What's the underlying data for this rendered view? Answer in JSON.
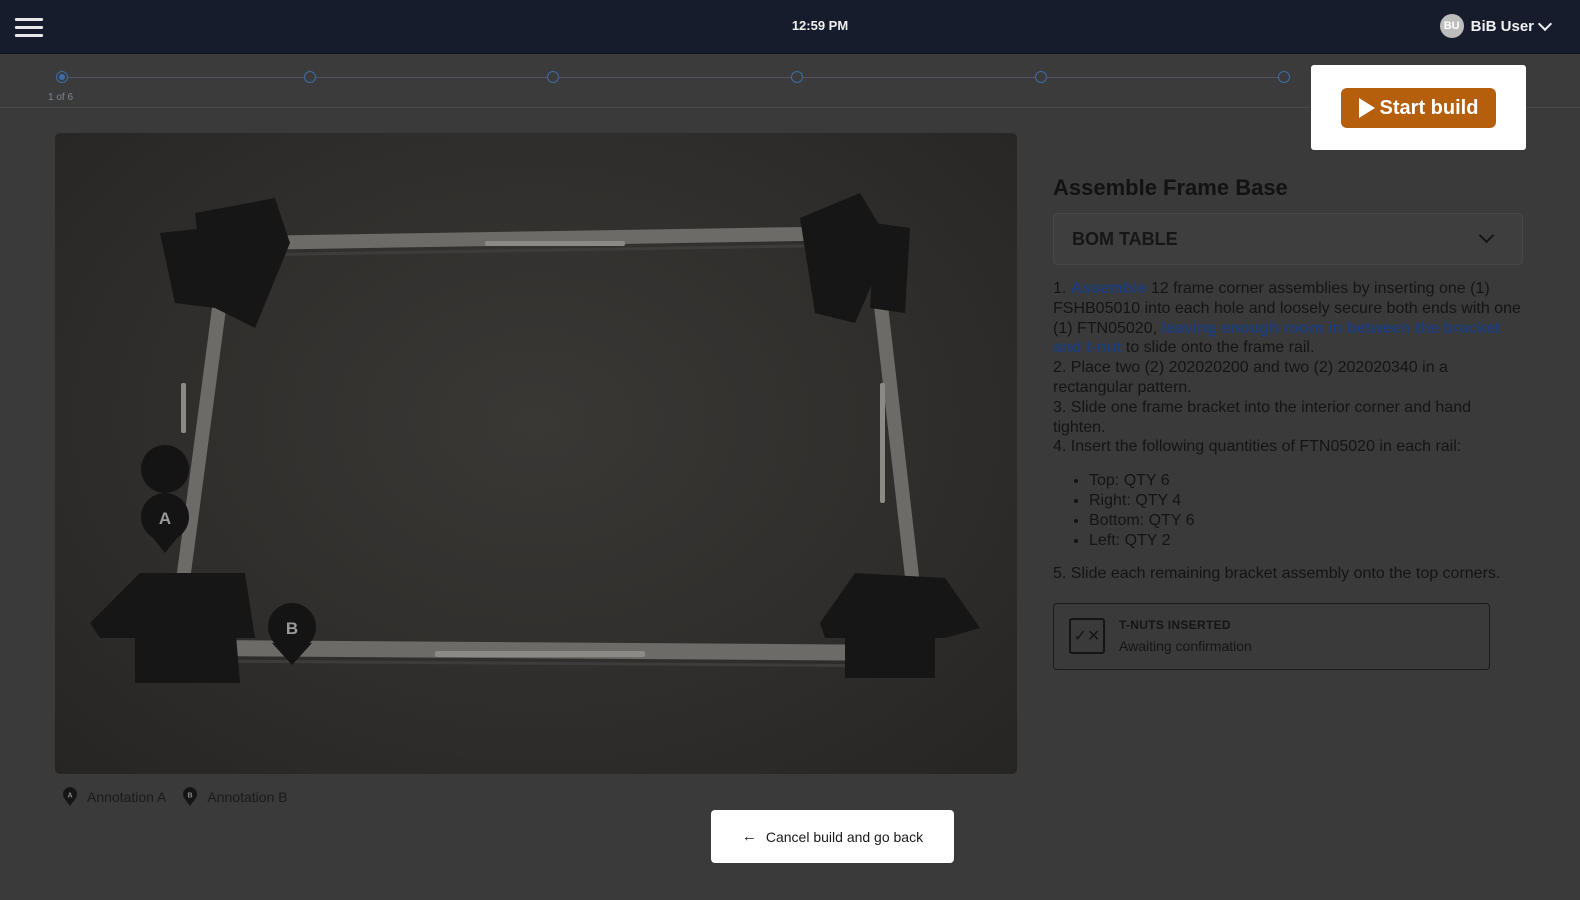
{
  "header": {
    "clock": "12:59 PM",
    "user": {
      "initials": "BU",
      "name": "BiB User"
    }
  },
  "stepper": {
    "total_steps": 6,
    "current_step": 1,
    "counter_text": "1 of 6"
  },
  "image": {
    "markers": [
      {
        "letter": "A"
      },
      {
        "letter": "B"
      }
    ]
  },
  "legend": {
    "items": [
      {
        "badge": "A",
        "label": "Annotation A"
      },
      {
        "badge": "B",
        "label": "Annotation B"
      }
    ]
  },
  "panel": {
    "title": "Assemble Frame Base",
    "bom_label": "BOM TABLE",
    "instructions": {
      "step1_num": "1. ",
      "step1_hl1": "Assemble",
      "step1_text1": " 12 frame corner assemblies by inserting one (1) FSHB05010 into each hole and loosely secure both ends with one (1) FTN05020, ",
      "step1_hl2": "leaving enough room in between the bracket and t-nut",
      "step1_text2": " to slide onto the frame rail.",
      "step2": "2. Place two (2) 202020200 and two (2) 202020340 in a rectangular pattern.",
      "step3": "3. Slide one frame bracket into the interior corner and hand tighten.",
      "step4": "4. Insert the following quantities of FTN05020 in each rail:",
      "rail_quantities": [
        "Top: QTY 6",
        "Right: QTY 4",
        "Bottom: QTY 6",
        "Left: QTY 2"
      ],
      "step5": "5. Slide each remaining bracket assembly onto the top corners."
    },
    "confirmation": {
      "title": "T-NUTS INSERTED",
      "status": "Awaiting confirmation",
      "icon": "check-x-icon"
    }
  },
  "actions": {
    "start_build_label": "Start build",
    "cancel_label": "Cancel build and go back"
  },
  "colors": {
    "topbar": "#161c2b",
    "overlay_background": "#3a3a3a",
    "start_button": "#b55e0c",
    "highlight_text": "#1d3d7a",
    "stepper_accent": "#3d6da8"
  }
}
